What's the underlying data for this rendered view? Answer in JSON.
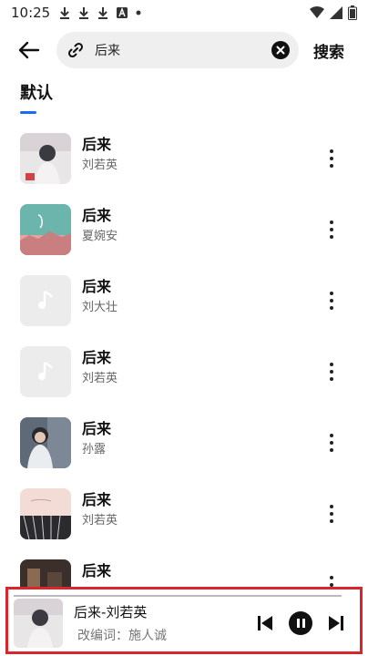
{
  "status_bar": {
    "time": "10:25",
    "left_icons": [
      "download-icon",
      "download-icon",
      "download-icon",
      "a-box-icon",
      "dot-icon"
    ],
    "right_icons": [
      "wifi-icon",
      "signal-icon",
      "battery-icon"
    ]
  },
  "header": {
    "search_value": "后来",
    "search_action_label": "搜索"
  },
  "tabs": [
    {
      "label": "默认",
      "active": true
    }
  ],
  "songs": [
    {
      "title": "后来",
      "artist": "刘若英",
      "cover": "photo-pale"
    },
    {
      "title": "后来",
      "artist": "夏婉安",
      "cover": "photo-teal"
    },
    {
      "title": "后来",
      "artist": "刘大壮",
      "cover": "music-note-placeholder"
    },
    {
      "title": "后来",
      "artist": "刘若英",
      "cover": "music-note-placeholder"
    },
    {
      "title": "后来",
      "artist": "孙露",
      "cover": "photo-portrait"
    },
    {
      "title": "后来",
      "artist": "刘若英",
      "cover": "photo-pink"
    },
    {
      "title": "后来",
      "artist": "",
      "cover": "photo-dark"
    }
  ],
  "player": {
    "now_playing": "后来-刘若英",
    "subtitle": "改编词：施人诚"
  },
  "colors": {
    "accent": "#1a6cf0",
    "highlight_border": "#d9262c"
  }
}
